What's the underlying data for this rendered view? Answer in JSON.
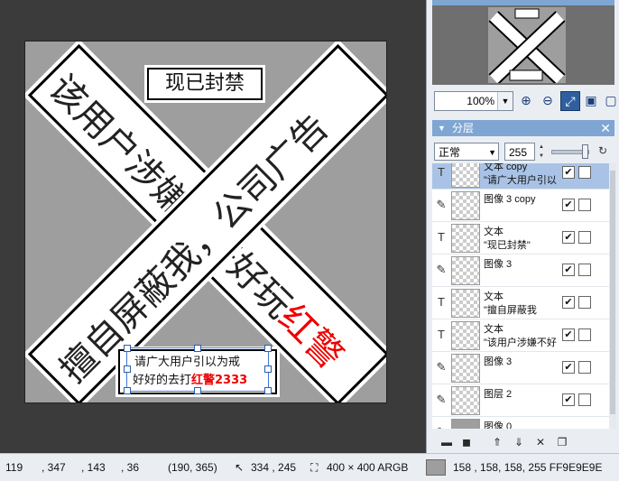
{
  "canvas": {
    "band1_text": "该用户涉嫌不好好玩",
    "band1_red": "红警",
    "band2_text": "擅自屏蔽我，公司广告",
    "title_box": "现已封禁",
    "bottom_line1": "请广大用户引以为戒",
    "bottom_line2_prefix": "好好的去打",
    "bottom_line2_red": "红警2333"
  },
  "navigator": {
    "preview_title": "现已封禁",
    "zoom_value": "100%"
  },
  "layers_panel": {
    "title": "分层",
    "blend_mode": "正常",
    "opacity": "255",
    "layers": [
      {
        "type": "text",
        "name": "文本 copy",
        "sub": "\"请广大用户引以",
        "selected": true,
        "visible": "✔"
      },
      {
        "type": "image",
        "name": "图像 3 copy",
        "sub": "",
        "selected": false,
        "visible": "✔"
      },
      {
        "type": "text",
        "name": "文本",
        "sub": "\"现已封禁\"",
        "selected": false,
        "visible": "✔"
      },
      {
        "type": "image",
        "name": "图像 3",
        "sub": "",
        "selected": false,
        "visible": "✔"
      },
      {
        "type": "text",
        "name": "文本",
        "sub": "\"擅自屏蔽我",
        "selected": false,
        "visible": "✔"
      },
      {
        "type": "text",
        "name": "文本",
        "sub": "\"该用户涉嫌不好",
        "selected": false,
        "visible": "✔"
      },
      {
        "type": "image",
        "name": "图像 3",
        "sub": "",
        "selected": false,
        "visible": "✔"
      },
      {
        "type": "image",
        "name": "图层 2",
        "sub": "",
        "selected": false,
        "visible": "✔"
      },
      {
        "type": "image",
        "name": "图像 0",
        "sub": "",
        "selected": false,
        "visible": ""
      }
    ]
  },
  "status_bar": {
    "coord_x": "119",
    "v2": ", 347",
    "v3": ", 143",
    "v4": ", 36",
    "cursor_pos": "(190, 365)",
    "pointer": "334 , 245",
    "size": "400 × 400 ARGB",
    "color_values": "158 , 158, 158, 255 FF9E9E9E",
    "swatch_color": "#9e9e9e"
  }
}
